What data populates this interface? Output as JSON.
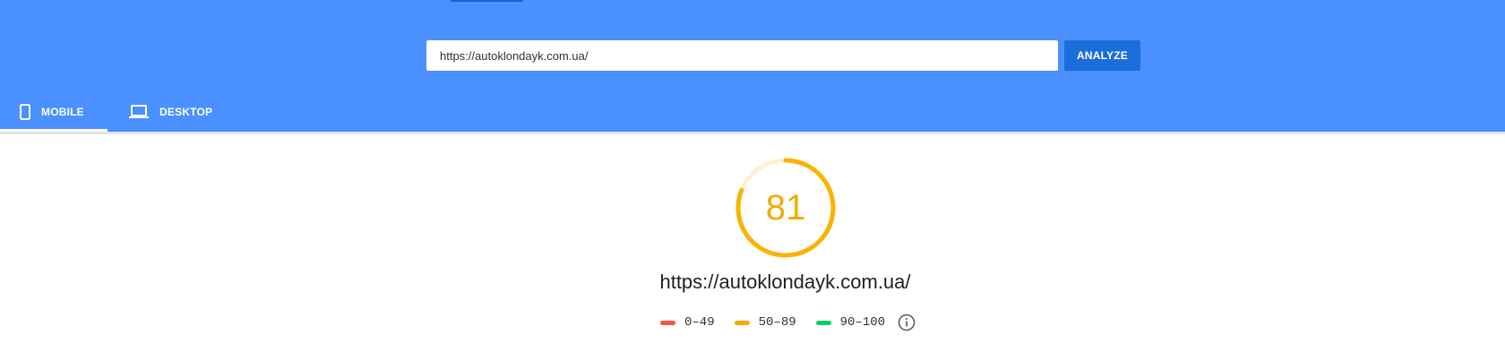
{
  "search": {
    "url_value": "https://autoklondayk.com.ua/",
    "analyze_label": "ANALYZE"
  },
  "tabs": [
    {
      "label": "MOBILE",
      "icon": "phone-icon",
      "active": true
    },
    {
      "label": "DESKTOP",
      "icon": "laptop-icon",
      "active": false
    }
  ],
  "result": {
    "score": "81",
    "score_fraction": 0.81,
    "url": "https://autoklondayk.com.ua/"
  },
  "legend": [
    {
      "range": "0–49",
      "color": "#ff4e42"
    },
    {
      "range": "50–89",
      "color": "#ffa400"
    },
    {
      "range": "90–100",
      "color": "#0cce6b"
    }
  ],
  "colors": {
    "header": "#4a90ff",
    "button": "#1a6ddb",
    "score": "#f2ab00",
    "gauge_track": "#fdf1d3"
  }
}
